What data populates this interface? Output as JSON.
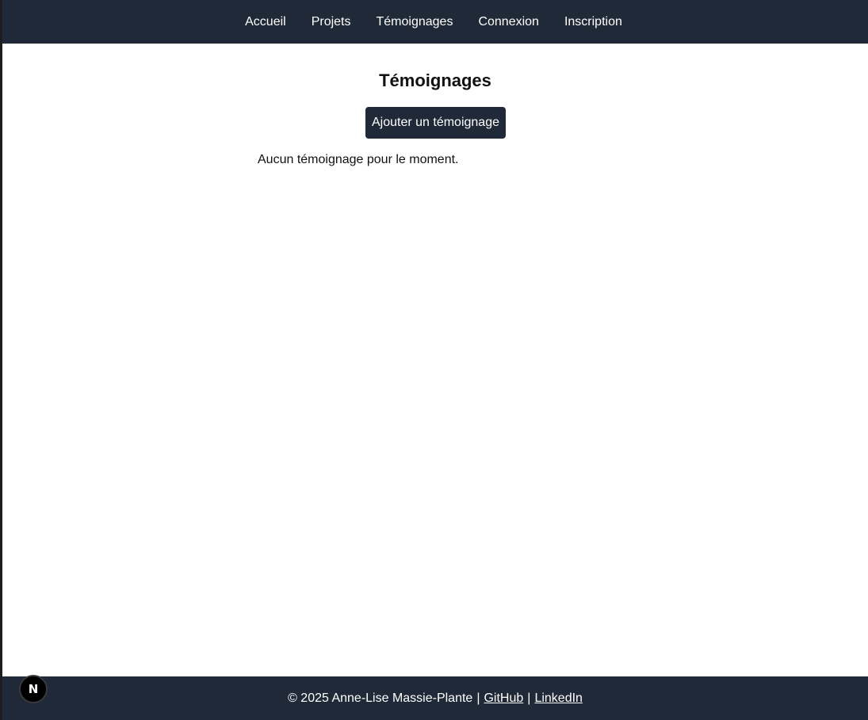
{
  "nav": {
    "items": [
      {
        "label": "Accueil"
      },
      {
        "label": "Projets"
      },
      {
        "label": "Témoignages"
      },
      {
        "label": "Connexion"
      },
      {
        "label": "Inscription"
      }
    ]
  },
  "main": {
    "title": "Témoignages",
    "add_button_label": "Ajouter un témoignage",
    "empty_message": "Aucun témoignage pour le moment."
  },
  "footer": {
    "copyright": "© 2025 Anne-Lise Massie-Plante",
    "separator": "|",
    "github_label": "GitHub",
    "linkedin_label": "LinkedIn"
  },
  "devtools": {
    "badge_label": "N"
  },
  "colors": {
    "nav_bg": "#1f2937",
    "footer_bg": "#1f2937",
    "button_bg": "#1f2937",
    "page_bg": "#ffffff"
  }
}
